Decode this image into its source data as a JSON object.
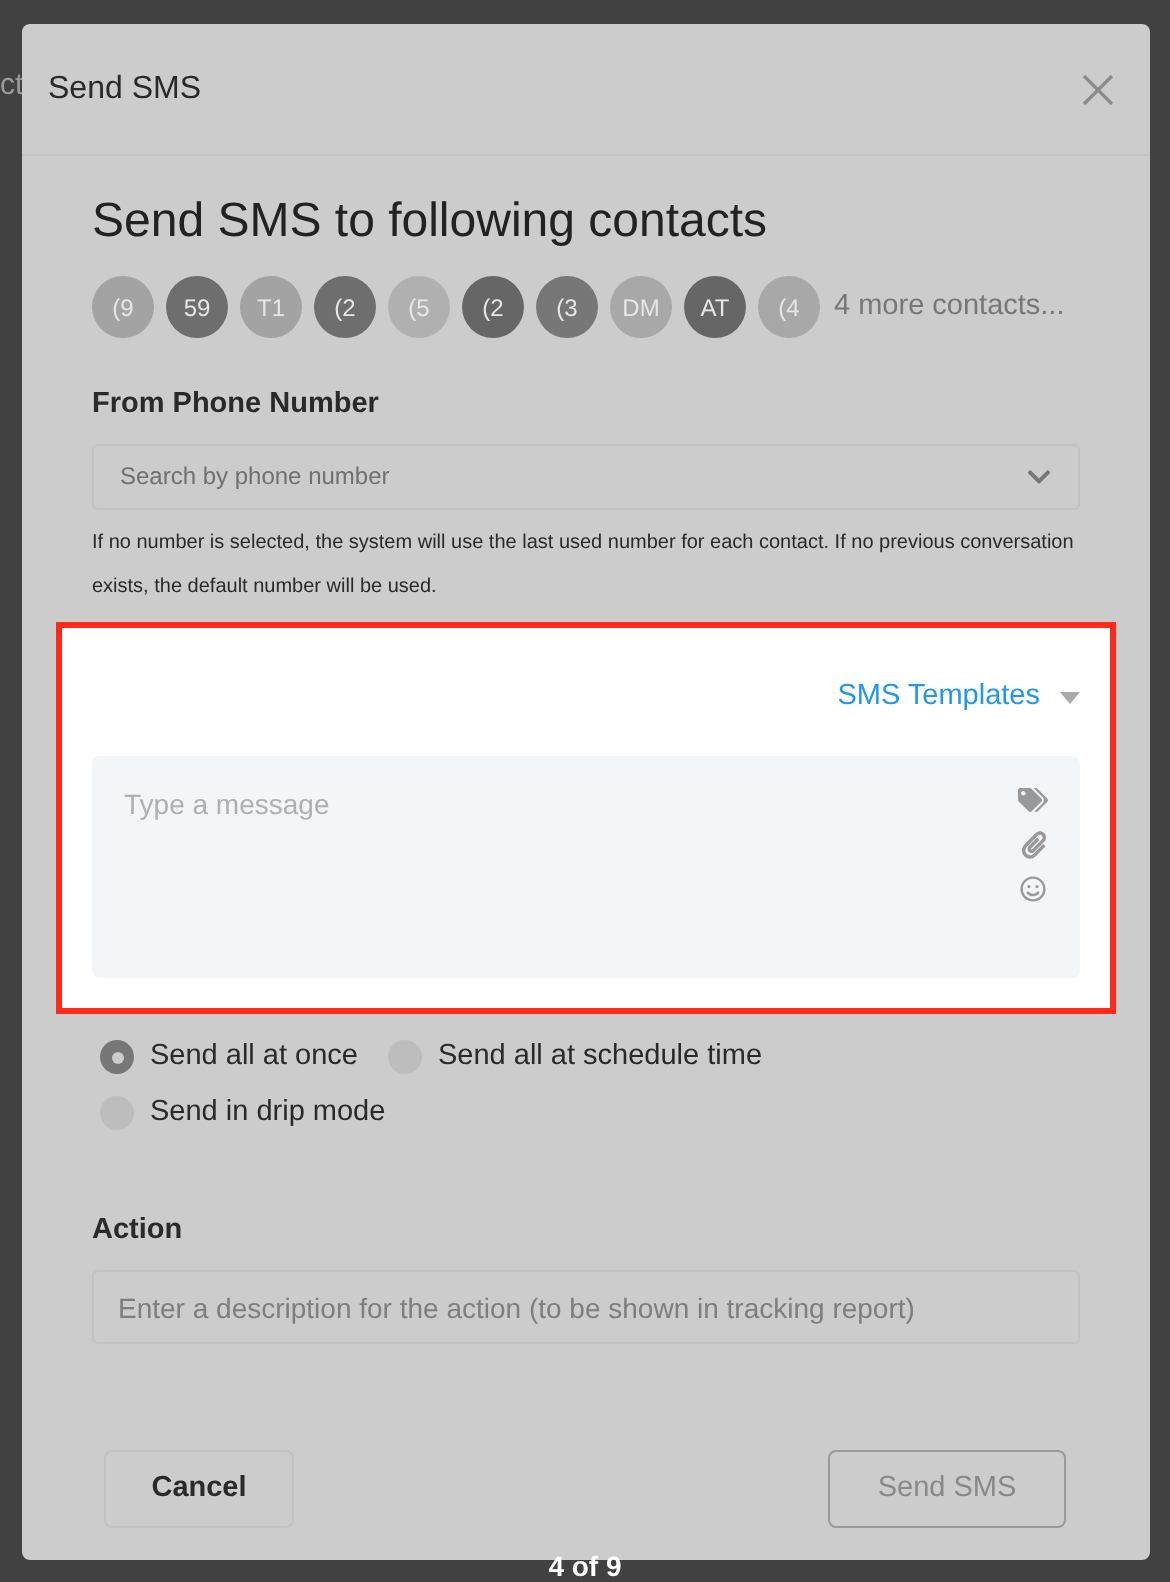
{
  "background_text": "ct",
  "modal": {
    "title": "Send SMS",
    "heading": "Send SMS to following contacts",
    "contacts": [
      {
        "initials": "(9",
        "color": "#a3a3a3"
      },
      {
        "initials": "59",
        "color": "#6e6e6e"
      },
      {
        "initials": "T1",
        "color": "#a3a3a3"
      },
      {
        "initials": "(2",
        "color": "#6e6e6e"
      },
      {
        "initials": "(5",
        "color": "#b0b0b0"
      },
      {
        "initials": "(2",
        "color": "#666666"
      },
      {
        "initials": "(3",
        "color": "#777777"
      },
      {
        "initials": "DM",
        "color": "#a8a8a8"
      },
      {
        "initials": "AT",
        "color": "#666666"
      },
      {
        "initials": "(4",
        "color": "#a8a8a8"
      }
    ],
    "more_contacts": "4 more contacts...",
    "from_label": "From Phone Number",
    "from_placeholder": "Search by phone number",
    "from_hint": "If no number is selected, the system will use the last used number for each contact. If no previous conversation exists, the default number will be used.",
    "templates": "SMS Templates",
    "message_placeholder": "Type a message",
    "send_modes": [
      {
        "label": "Send all at once",
        "selected": true
      },
      {
        "label": "Send all at schedule time",
        "selected": false
      },
      {
        "label": "Send in drip mode",
        "selected": false
      }
    ],
    "action_label": "Action",
    "action_placeholder": "Enter a description for the action (to be shown in tracking report)",
    "buttons": [
      {
        "label": "Cancel",
        "kind": "secondary"
      },
      {
        "label": "Send SMS",
        "kind": "primary"
      }
    ]
  },
  "pager": "4 of 9"
}
